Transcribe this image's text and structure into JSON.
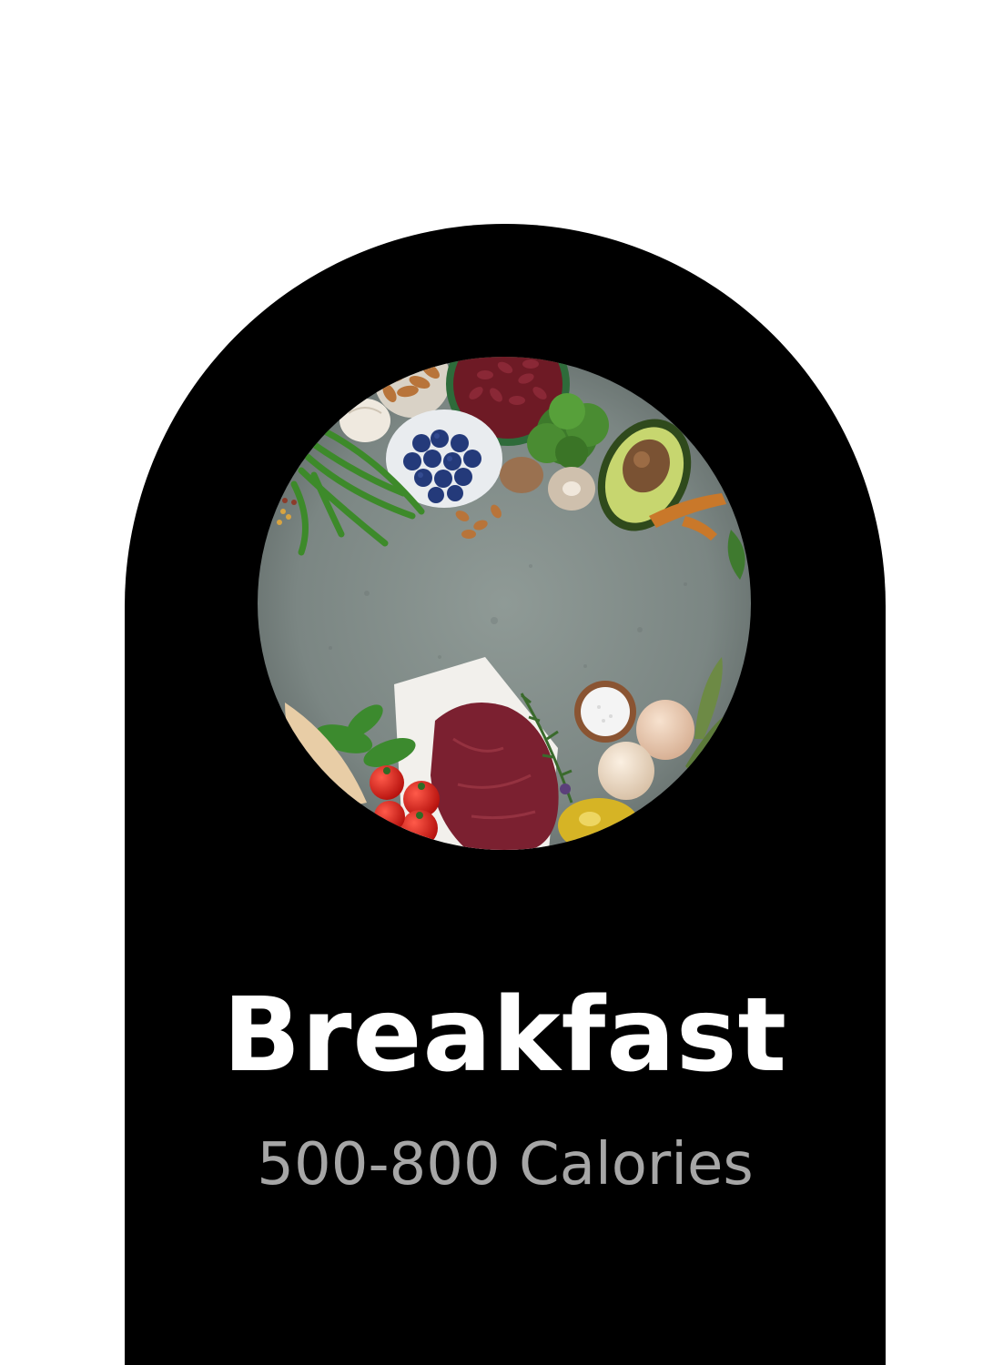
{
  "card": {
    "title": "Breakfast",
    "subtitle": "500-800 Calories",
    "background_color": "#000000",
    "title_color": "#ffffff",
    "subtitle_color": "#a6a6a6"
  },
  "photo": {
    "subject": "healthy food flat lay",
    "items": [
      "almonds",
      "kidney-beans",
      "garlic",
      "blueberries",
      "broccoli",
      "avocado",
      "mushrooms",
      "green-beans",
      "turmeric",
      "salt",
      "eggs",
      "steak",
      "cherry-tomatoes",
      "basil",
      "rosemary",
      "sage",
      "olive-oil"
    ]
  }
}
